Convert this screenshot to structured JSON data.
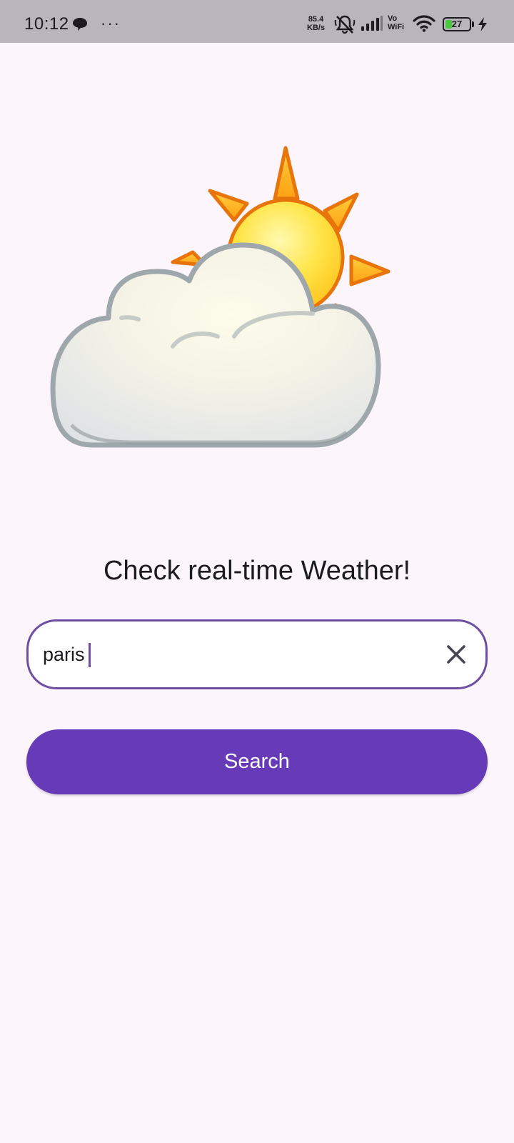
{
  "status_bar": {
    "time": "10:12",
    "more": "···",
    "net_speed_value": "85.4",
    "net_speed_unit": "KB/s",
    "vo_label": "Vo",
    "wifi_label": "WiFi",
    "battery_level": "27",
    "icons": [
      "chat-icon",
      "more-icon",
      "mute-icon",
      "signal-icon",
      "wifi-icon",
      "battery-icon",
      "charging-icon"
    ]
  },
  "main": {
    "illustration_icon": "sun-behind-cloud-icon",
    "headline": "Check real-time Weather!",
    "search_field": {
      "value": "paris",
      "clear_icon": "close-icon"
    },
    "search_button_label": "Search"
  },
  "colors": {
    "background": "#fdf5fc",
    "status_bar": "#bab5bc",
    "accent": "#673ab7",
    "field_border": "#6c4fa4",
    "battery_fill": "#4bc940"
  }
}
